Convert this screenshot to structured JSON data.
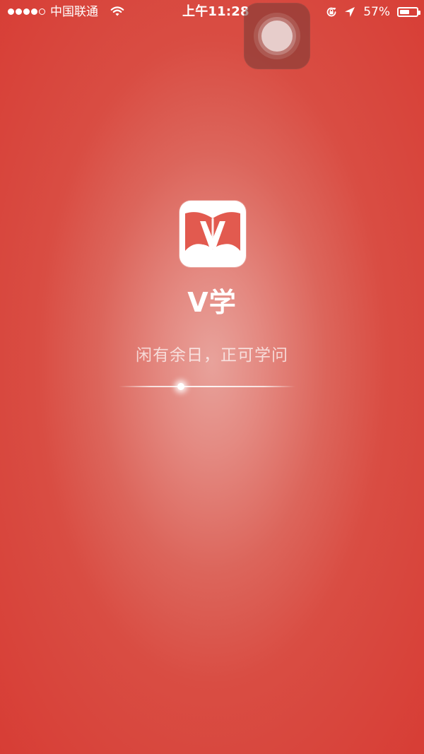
{
  "status_bar": {
    "carrier": "中国联通",
    "time": "上午11:28",
    "battery_percent_text": "57%",
    "battery_level": 0.57
  },
  "app": {
    "name": "V学",
    "slogan": "闲有余日，正可学问"
  },
  "loading": {
    "progress": 0.35
  },
  "icons": {
    "signal": "signal-dots-icon",
    "wifi": "wifi-icon",
    "lock_rotate": "rotation-lock-icon",
    "location": "location-icon",
    "battery": "battery-icon",
    "assistive_touch": "assistive-touch-icon",
    "logo": "book-logo-icon"
  },
  "colors": {
    "background": "#d94d43",
    "center_glow": "#e8a29b",
    "white": "#ffffff"
  }
}
